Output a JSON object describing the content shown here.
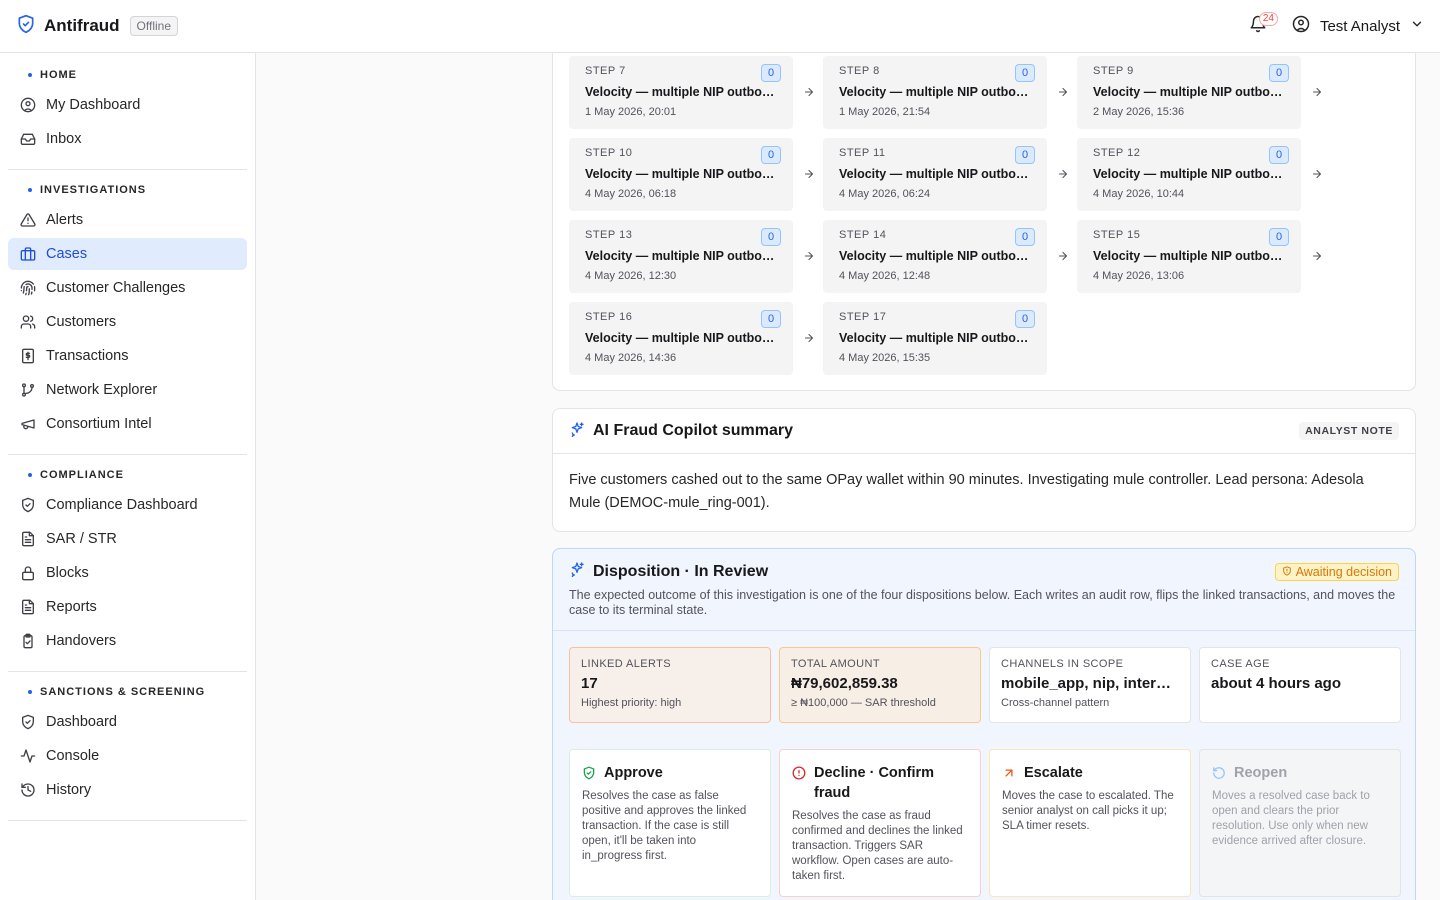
{
  "app": {
    "title": "Antifraud",
    "status_badge": "Offline"
  },
  "header": {
    "notification_count": "24",
    "user_name": "Test Analyst"
  },
  "sidebar": {
    "sections": [
      {
        "title": "HOME",
        "items": [
          {
            "label": "My Dashboard",
            "icon": "user-circle-icon"
          },
          {
            "label": "Inbox",
            "icon": "inbox-icon"
          }
        ]
      },
      {
        "title": "INVESTIGATIONS",
        "items": [
          {
            "label": "Alerts",
            "icon": "warning-icon"
          },
          {
            "label": "Cases",
            "icon": "briefcase-icon",
            "active": true
          },
          {
            "label": "Customer Challenges",
            "icon": "fingerprint-icon"
          },
          {
            "label": "Customers",
            "icon": "users-icon"
          },
          {
            "label": "Transactions",
            "icon": "receipt-icon"
          },
          {
            "label": "Network Explorer",
            "icon": "git-branch-icon"
          },
          {
            "label": "Consortium Intel",
            "icon": "megaphone-icon"
          }
        ]
      },
      {
        "title": "COMPLIANCE",
        "items": [
          {
            "label": "Compliance Dashboard",
            "icon": "shield-check-icon"
          },
          {
            "label": "SAR / STR",
            "icon": "file-text-icon"
          },
          {
            "label": "Blocks",
            "icon": "lock-icon"
          },
          {
            "label": "Reports",
            "icon": "file-text-icon"
          },
          {
            "label": "Handovers",
            "icon": "clipboard-check-icon"
          }
        ]
      },
      {
        "title": "SANCTIONS & SCREENING",
        "items": [
          {
            "label": "Dashboard",
            "icon": "shield-check-icon"
          },
          {
            "label": "Console",
            "icon": "activity-icon"
          },
          {
            "label": "History",
            "icon": "history-icon"
          }
        ]
      }
    ]
  },
  "timeline": {
    "steps": [
      {
        "label": "STEP 7",
        "count": "0",
        "title": "Velocity — multiple NIP outbou…",
        "date": "1 May 2026, 20:01"
      },
      {
        "label": "STEP 8",
        "count": "0",
        "title": "Velocity — multiple NIP outbou…",
        "date": "1 May 2026, 21:54"
      },
      {
        "label": "STEP 9",
        "count": "0",
        "title": "Velocity — multiple NIP outbou…",
        "date": "2 May 2026, 15:36"
      },
      {
        "label": "STEP 10",
        "count": "0",
        "title": "Velocity — multiple NIP outbou…",
        "date": "4 May 2026, 06:18"
      },
      {
        "label": "STEP 11",
        "count": "0",
        "title": "Velocity — multiple NIP outbou…",
        "date": "4 May 2026, 06:24"
      },
      {
        "label": "STEP 12",
        "count": "0",
        "title": "Velocity — multiple NIP outbou…",
        "date": "4 May 2026, 10:44"
      },
      {
        "label": "STEP 13",
        "count": "0",
        "title": "Velocity — multiple NIP outbou…",
        "date": "4 May 2026, 12:30"
      },
      {
        "label": "STEP 14",
        "count": "0",
        "title": "Velocity — multiple NIP outbou…",
        "date": "4 May 2026, 12:48"
      },
      {
        "label": "STEP 15",
        "count": "0",
        "title": "Velocity — multiple NIP outbou…",
        "date": "4 May 2026, 13:06"
      },
      {
        "label": "STEP 16",
        "count": "0",
        "title": "Velocity — multiple NIP outbou…",
        "date": "4 May 2026, 14:36"
      },
      {
        "label": "STEP 17",
        "count": "0",
        "title": "Velocity — multiple NIP outbou…",
        "date": "4 May 2026, 15:35"
      }
    ]
  },
  "copilot": {
    "title": "AI Fraud Copilot summary",
    "badge": "ANALYST NOTE",
    "body": "Five customers cashed out to the same OPay wallet within 90 minutes. Investigating mule controller. Lead persona: Adesola Mule (DEMOC-mule_ring-001)."
  },
  "disposition": {
    "title": "Disposition · In Review",
    "status": "Awaiting decision",
    "description": "The expected outcome of this investigation is one of the four dispositions below. Each writes an audit row, flips the linked transactions, and moves the case to its terminal state.",
    "metrics": [
      {
        "label": "LINKED ALERTS",
        "value": "17",
        "sub": "Highest priority: high"
      },
      {
        "label": "TOTAL AMOUNT",
        "value": "₦79,602,859.38",
        "sub": "≥ ₦100,000 — SAR threshold"
      },
      {
        "label": "CHANNELS IN SCOPE",
        "value": "mobile_app, nip, interne…",
        "sub": "Cross-channel pattern"
      },
      {
        "label": "CASE AGE",
        "value": "about 4 hours ago",
        "sub": ""
      }
    ],
    "actions": [
      {
        "title": "Approve",
        "desc": "Resolves the case as false positive and approves the linked transaction. If the case is still open, it'll be taken into in_progress first.",
        "color": "#16a34a"
      },
      {
        "title": "Decline · Confirm fraud",
        "desc": "Resolves the case as fraud confirmed and declines the linked transaction. Triggers SAR workflow. Open cases are auto-taken first.",
        "color": "#dc2626"
      },
      {
        "title": "Escalate",
        "desc": "Moves the case to escalated. The senior analyst on call picks it up; SLA timer resets.",
        "color": "#ea580c"
      },
      {
        "title": "Reopen",
        "desc": "Moves a resolved case back to open and clears the prior resolution. Use only when new evidence arrived after closure.",
        "color": "#93c5fd"
      }
    ]
  },
  "colors": {
    "accent": "#2563eb",
    "active_bg": "#e0ebfd",
    "warning": "#d97706",
    "danger": "#dc2626",
    "success": "#16a34a"
  }
}
